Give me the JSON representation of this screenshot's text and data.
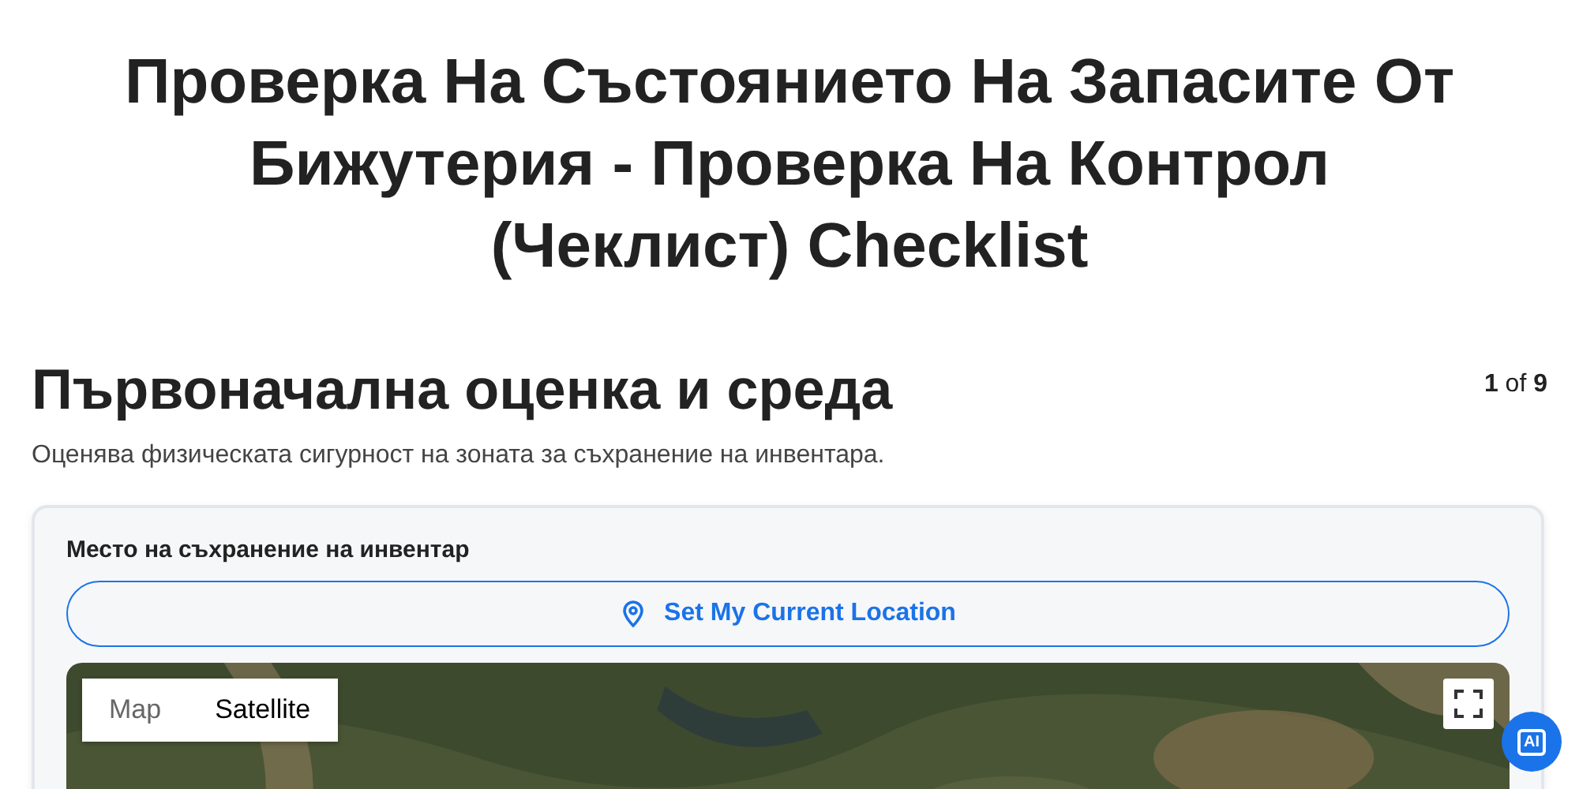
{
  "title": "Проверка На Състоянието На Запасите От Бижутерия - Проверка На Контрол (Чеклист) Checklist",
  "section": {
    "heading": "Първоначална оценка и среда",
    "progress": "**1** of **9**",
    "description": "Оценява физическата сигурност на зоната за съхранение на инвентара."
  },
  "field": {
    "label": "Место на съхранение на инвентар",
    "button": "Set My Current Location"
  },
  "map": {
    "types": [
      {
        "label": "Map",
        "selected": false
      },
      {
        "label": "Satellite",
        "selected": true
      }
    ]
  },
  "ai_badge": {
    "label": "AI"
  }
}
